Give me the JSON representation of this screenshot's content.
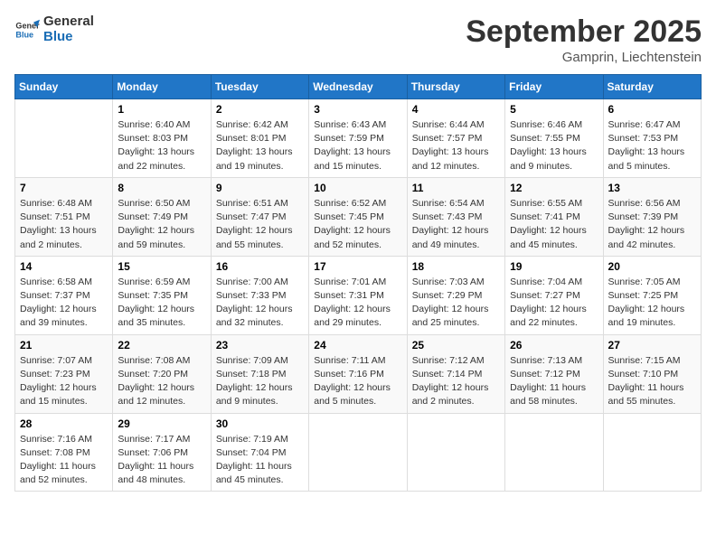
{
  "logo": {
    "text1": "General",
    "text2": "Blue"
  },
  "title": "September 2025",
  "subtitle": "Gamprin, Liechtenstein",
  "days_header": [
    "Sunday",
    "Monday",
    "Tuesday",
    "Wednesday",
    "Thursday",
    "Friday",
    "Saturday"
  ],
  "weeks": [
    [
      {
        "day": "",
        "info": ""
      },
      {
        "day": "1",
        "info": "Sunrise: 6:40 AM\nSunset: 8:03 PM\nDaylight: 13 hours\nand 22 minutes."
      },
      {
        "day": "2",
        "info": "Sunrise: 6:42 AM\nSunset: 8:01 PM\nDaylight: 13 hours\nand 19 minutes."
      },
      {
        "day": "3",
        "info": "Sunrise: 6:43 AM\nSunset: 7:59 PM\nDaylight: 13 hours\nand 15 minutes."
      },
      {
        "day": "4",
        "info": "Sunrise: 6:44 AM\nSunset: 7:57 PM\nDaylight: 13 hours\nand 12 minutes."
      },
      {
        "day": "5",
        "info": "Sunrise: 6:46 AM\nSunset: 7:55 PM\nDaylight: 13 hours\nand 9 minutes."
      },
      {
        "day": "6",
        "info": "Sunrise: 6:47 AM\nSunset: 7:53 PM\nDaylight: 13 hours\nand 5 minutes."
      }
    ],
    [
      {
        "day": "7",
        "info": "Sunrise: 6:48 AM\nSunset: 7:51 PM\nDaylight: 13 hours\nand 2 minutes."
      },
      {
        "day": "8",
        "info": "Sunrise: 6:50 AM\nSunset: 7:49 PM\nDaylight: 12 hours\nand 59 minutes."
      },
      {
        "day": "9",
        "info": "Sunrise: 6:51 AM\nSunset: 7:47 PM\nDaylight: 12 hours\nand 55 minutes."
      },
      {
        "day": "10",
        "info": "Sunrise: 6:52 AM\nSunset: 7:45 PM\nDaylight: 12 hours\nand 52 minutes."
      },
      {
        "day": "11",
        "info": "Sunrise: 6:54 AM\nSunset: 7:43 PM\nDaylight: 12 hours\nand 49 minutes."
      },
      {
        "day": "12",
        "info": "Sunrise: 6:55 AM\nSunset: 7:41 PM\nDaylight: 12 hours\nand 45 minutes."
      },
      {
        "day": "13",
        "info": "Sunrise: 6:56 AM\nSunset: 7:39 PM\nDaylight: 12 hours\nand 42 minutes."
      }
    ],
    [
      {
        "day": "14",
        "info": "Sunrise: 6:58 AM\nSunset: 7:37 PM\nDaylight: 12 hours\nand 39 minutes."
      },
      {
        "day": "15",
        "info": "Sunrise: 6:59 AM\nSunset: 7:35 PM\nDaylight: 12 hours\nand 35 minutes."
      },
      {
        "day": "16",
        "info": "Sunrise: 7:00 AM\nSunset: 7:33 PM\nDaylight: 12 hours\nand 32 minutes."
      },
      {
        "day": "17",
        "info": "Sunrise: 7:01 AM\nSunset: 7:31 PM\nDaylight: 12 hours\nand 29 minutes."
      },
      {
        "day": "18",
        "info": "Sunrise: 7:03 AM\nSunset: 7:29 PM\nDaylight: 12 hours\nand 25 minutes."
      },
      {
        "day": "19",
        "info": "Sunrise: 7:04 AM\nSunset: 7:27 PM\nDaylight: 12 hours\nand 22 minutes."
      },
      {
        "day": "20",
        "info": "Sunrise: 7:05 AM\nSunset: 7:25 PM\nDaylight: 12 hours\nand 19 minutes."
      }
    ],
    [
      {
        "day": "21",
        "info": "Sunrise: 7:07 AM\nSunset: 7:23 PM\nDaylight: 12 hours\nand 15 minutes."
      },
      {
        "day": "22",
        "info": "Sunrise: 7:08 AM\nSunset: 7:20 PM\nDaylight: 12 hours\nand 12 minutes."
      },
      {
        "day": "23",
        "info": "Sunrise: 7:09 AM\nSunset: 7:18 PM\nDaylight: 12 hours\nand 9 minutes."
      },
      {
        "day": "24",
        "info": "Sunrise: 7:11 AM\nSunset: 7:16 PM\nDaylight: 12 hours\nand 5 minutes."
      },
      {
        "day": "25",
        "info": "Sunrise: 7:12 AM\nSunset: 7:14 PM\nDaylight: 12 hours\nand 2 minutes."
      },
      {
        "day": "26",
        "info": "Sunrise: 7:13 AM\nSunset: 7:12 PM\nDaylight: 11 hours\nand 58 minutes."
      },
      {
        "day": "27",
        "info": "Sunrise: 7:15 AM\nSunset: 7:10 PM\nDaylight: 11 hours\nand 55 minutes."
      }
    ],
    [
      {
        "day": "28",
        "info": "Sunrise: 7:16 AM\nSunset: 7:08 PM\nDaylight: 11 hours\nand 52 minutes."
      },
      {
        "day": "29",
        "info": "Sunrise: 7:17 AM\nSunset: 7:06 PM\nDaylight: 11 hours\nand 48 minutes."
      },
      {
        "day": "30",
        "info": "Sunrise: 7:19 AM\nSunset: 7:04 PM\nDaylight: 11 hours\nand 45 minutes."
      },
      {
        "day": "",
        "info": ""
      },
      {
        "day": "",
        "info": ""
      },
      {
        "day": "",
        "info": ""
      },
      {
        "day": "",
        "info": ""
      }
    ]
  ]
}
